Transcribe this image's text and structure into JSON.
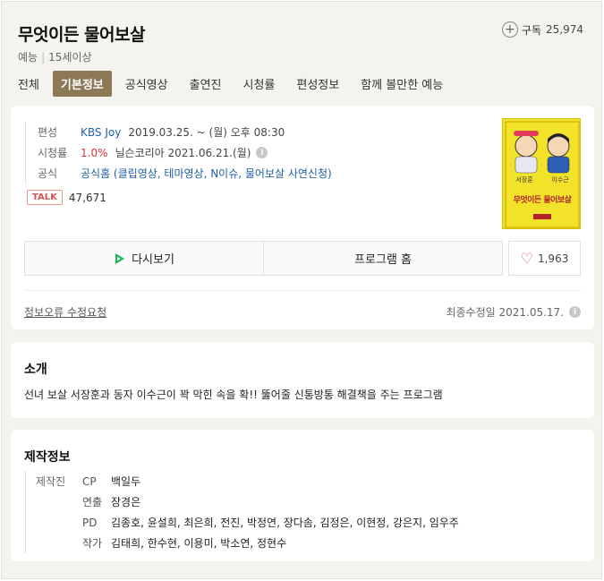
{
  "header": {
    "title": "무엇이든 물어보살",
    "genre": "예능",
    "rating": "15세이상",
    "subscribe_label": "구독",
    "subscribe_count": "25,974"
  },
  "tabs": [
    "전체",
    "기본정보",
    "공식영상",
    "출연진",
    "시청률",
    "편성정보",
    "함께 볼만한 예능"
  ],
  "info": {
    "broadcast_label": "편성",
    "channel": "KBS Joy",
    "schedule": "2019.03.25. ~  (월) 오후 08:30",
    "viewership_label": "시청률",
    "viewership_value": "1.0%",
    "viewership_source": "닐슨코리아 2021.06.21.(월)",
    "official_label": "공식",
    "official_links": "공식홈 (클립영상, 테마영상, N이슈, 물어보살 사연신청)",
    "talk_badge": "TALK",
    "talk_count": "47,671"
  },
  "poster": {
    "title": "무엇이든 물어보살",
    "left_name": "서장훈",
    "right_name": "이수근",
    "background": "#f3e22a"
  },
  "buttons": {
    "replay": "다시보기",
    "home": "프로그램 홈",
    "like_count": "1,963"
  },
  "footer": {
    "report": "정보오류 수정요청",
    "updated": "최종수정일 2021.05.17."
  },
  "intro": {
    "heading": "소개",
    "text": "선녀 보살 서장훈과 동자 이수근이 꽉 막힌 속을 확!! 뚫어줄 신통방통 해결책을 주는 프로그램"
  },
  "production": {
    "heading": "제작정보",
    "label": "제작진",
    "roles": [
      {
        "role": "CP",
        "names": "백일두"
      },
      {
        "role": "연출",
        "names": "장경은"
      },
      {
        "role": "PD",
        "names": "김종호, 윤설희, 최은희, 전진, 박정연, 장다솜, 김정은, 이현정, 강은지, 임우주"
      },
      {
        "role": "작가",
        "names": "김태희, 한수현, 이용미, 박소연, 정현수"
      }
    ]
  },
  "colors": {
    "accent_tab": "#8c7a57",
    "link_blue": "#1e5fa8",
    "rating_red": "#e03131"
  }
}
